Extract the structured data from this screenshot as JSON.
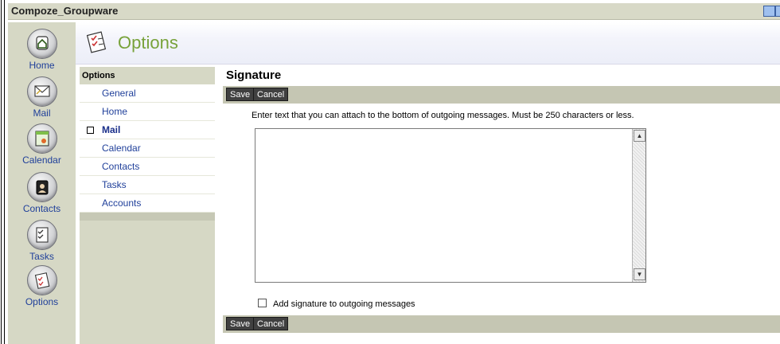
{
  "app": {
    "title": "Compoze_Groupware"
  },
  "nav": {
    "items": [
      {
        "label": "Home",
        "icon": "house-icon"
      },
      {
        "label": "Mail",
        "icon": "mail-icon"
      },
      {
        "label": "Calendar",
        "icon": "calendar-icon"
      },
      {
        "label": "Contacts",
        "icon": "contacts-icon"
      },
      {
        "label": "Tasks",
        "icon": "tasks-icon"
      },
      {
        "label": "Options",
        "icon": "options-icon"
      }
    ]
  },
  "header": {
    "title": "Options",
    "icon": "options-checklist-icon"
  },
  "options_menu": {
    "heading": "Options",
    "items": [
      {
        "label": "General"
      },
      {
        "label": "Home"
      },
      {
        "label": "Mail",
        "active": true
      },
      {
        "label": "Calendar"
      },
      {
        "label": "Contacts"
      },
      {
        "label": "Tasks"
      },
      {
        "label": "Accounts"
      }
    ]
  },
  "main": {
    "title": "Signature",
    "save_label": "Save",
    "cancel_label": "Cancel",
    "description": "Enter text that you can attach to the bottom of outgoing messages. Must be 250 characters or less.",
    "signature_value": "",
    "checkbox_label": "Add signature to outgoing messages",
    "checkbox_checked": false
  },
  "colors": {
    "sidebar": "#d6d8c5",
    "toolbar": "#c5c6b3",
    "header_title": "#78a23a",
    "link": "#1f3f9a",
    "button": "#404040"
  }
}
